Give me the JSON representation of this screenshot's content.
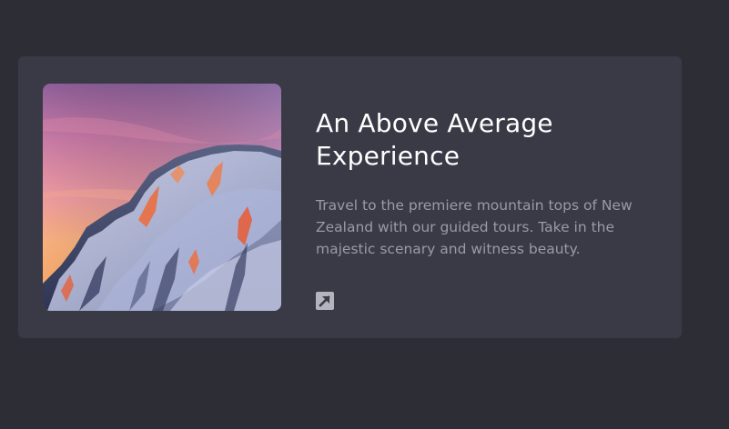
{
  "card": {
    "image_alt": "Snow-covered mountain peak at sunset",
    "title": "An Above Average Experience",
    "description": "Travel to the premiere mountain tops of New Zealand with our guided tours. Take in the majestic scenary and witness beauty.",
    "link_icon": "external-link-arrow-icon"
  },
  "colors": {
    "background": "#2d2d36",
    "card": "#393a46",
    "title": "#ffffff",
    "text": "#9a9aa8",
    "icon": "#b4b4be"
  }
}
